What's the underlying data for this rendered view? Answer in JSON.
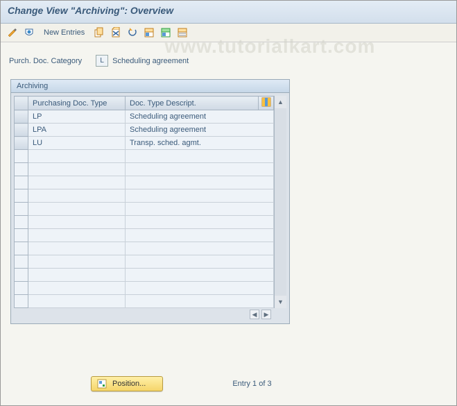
{
  "title": "Change View \"Archiving\": Overview",
  "toolbar": {
    "new_entries": "New Entries"
  },
  "filter": {
    "label": "Purch. Doc. Category",
    "code": "L",
    "value": "Scheduling agreement"
  },
  "panel": {
    "title": "Archiving",
    "columns": {
      "col1": "Purchasing Doc. Type",
      "col2": "Doc. Type Descript."
    },
    "rows": [
      {
        "type": "LP",
        "desc": "Scheduling agreement"
      },
      {
        "type": "LPA",
        "desc": "Scheduling agreement"
      },
      {
        "type": "LU",
        "desc": "Transp. sched. agmt."
      }
    ]
  },
  "footer": {
    "position_label": "Position...",
    "entry_text": "Entry 1 of 3"
  },
  "watermark": "www.tutorialkart.com"
}
